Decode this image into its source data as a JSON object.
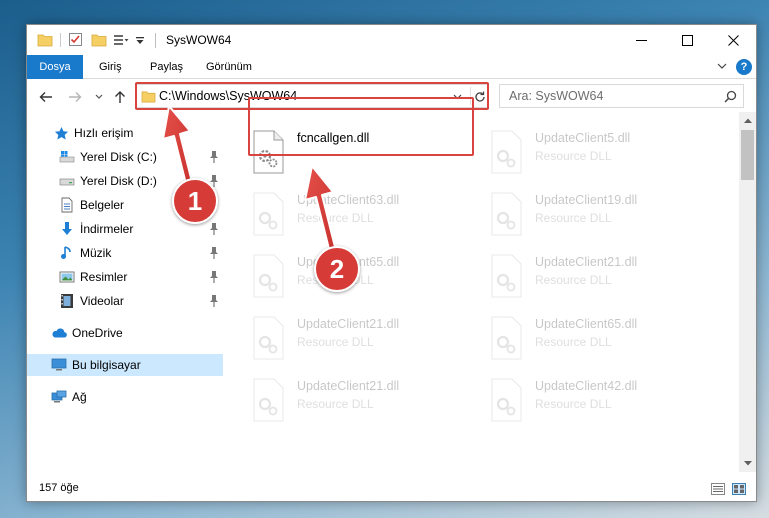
{
  "window": {
    "title": "SysWOW64",
    "controls": {
      "minimize": "minimize",
      "maximize": "maximize",
      "close": "close"
    }
  },
  "ribbon": {
    "tabs": [
      "Dosya",
      "Giriş",
      "Paylaş",
      "Görünüm"
    ],
    "help": "?"
  },
  "address": {
    "path": "C:\\Windows\\SysWOW64",
    "search_placeholder": "Ara: SysWOW64"
  },
  "sidebar": {
    "items": [
      {
        "label": "Hızlı erişim",
        "icon": "star-icon",
        "pinned": false
      },
      {
        "label": "Yerel Disk (C:)",
        "icon": "windows-drive-icon",
        "pinned": true
      },
      {
        "label": "Yerel Disk (D:)",
        "icon": "drive-icon",
        "pinned": true
      },
      {
        "label": "Belgeler",
        "icon": "document-icon",
        "pinned": true
      },
      {
        "label": "İndirmeler",
        "icon": "download-icon",
        "pinned": true
      },
      {
        "label": "Müzik",
        "icon": "music-icon",
        "pinned": true
      },
      {
        "label": "Resimler",
        "icon": "pictures-icon",
        "pinned": true
      },
      {
        "label": "Videolar",
        "icon": "video-icon",
        "pinned": true
      },
      {
        "label": "OneDrive",
        "icon": "cloud-icon",
        "pinned": false
      },
      {
        "label": "Bu bilgisayar",
        "icon": "computer-icon",
        "pinned": false,
        "selected": true
      },
      {
        "label": "Ağ",
        "icon": "network-icon",
        "pinned": false
      }
    ]
  },
  "files": [
    {
      "name": "fcncallgen.dll",
      "type": "",
      "highlighted": true
    },
    {
      "name": "UpdateClient5.dll",
      "type": "Resource DLL"
    },
    {
      "name": "UpdateClient63.dll",
      "type": "Resource DLL"
    },
    {
      "name": "UpdateClient19.dll",
      "type": "Resource DLL"
    },
    {
      "name": "UpdateClient65.dll",
      "type": "Resource DLL"
    },
    {
      "name": "UpdateClient21.dll",
      "type": "Resource DLL"
    },
    {
      "name": "UpdateClient21.dll",
      "type": "Resource DLL"
    },
    {
      "name": "UpdateClient65.dll",
      "type": "Resource DLL"
    },
    {
      "name": "UpdateClient21.dll",
      "type": "Resource DLL"
    },
    {
      "name": "UpdateClient42.dll",
      "type": "Resource DLL"
    }
  ],
  "status": {
    "item_count": "157 öğe"
  },
  "callouts": [
    "1",
    "2"
  ],
  "colors": {
    "accent": "#1979ca",
    "highlight": "#d9443f",
    "selected_bg": "#cce8ff"
  }
}
